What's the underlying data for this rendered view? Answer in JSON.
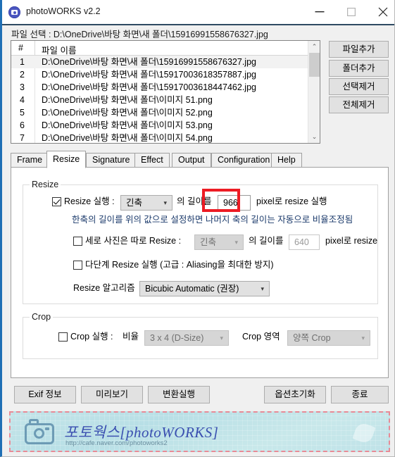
{
  "window": {
    "title": "photoWORKS v2.2",
    "icon": "camera-circle-icon",
    "controls": {
      "minimize": "—",
      "maximize": "□",
      "close": "✕"
    }
  },
  "path_line": "파일 선택 :  D:\\OneDrive\\바탕 화면\\새 폴더\\15916991558676327.jpg",
  "file_list": {
    "columns": [
      "#",
      "파일 이름"
    ],
    "rows": [
      {
        "num": "1",
        "name": "D:\\OneDrive\\바탕 화면\\새 폴더\\15916991558676327.jpg"
      },
      {
        "num": "2",
        "name": "D:\\OneDrive\\바탕 화면\\새 폴더\\15917003618357887.jpg"
      },
      {
        "num": "3",
        "name": "D:\\OneDrive\\바탕 화면\\새 폴더\\15917003618447462.jpg"
      },
      {
        "num": "4",
        "name": "D:\\OneDrive\\바탕 화면\\새 폴더\\이미지 51.png"
      },
      {
        "num": "5",
        "name": "D:\\OneDrive\\바탕 화면\\새 폴더\\이미지 52.png"
      },
      {
        "num": "6",
        "name": "D:\\OneDrive\\바탕 화면\\새 폴더\\이미지 53.png"
      },
      {
        "num": "7",
        "name": "D:\\OneDrive\\바탕 화면\\새 폴더\\이미지 54.png"
      }
    ],
    "scrollbar": {
      "up": "⌃",
      "down": "⌄"
    }
  },
  "side_buttons": [
    {
      "label": "파일추가"
    },
    {
      "label": "폴더추가"
    },
    {
      "label": "선택제거"
    },
    {
      "label": "전체제거"
    }
  ],
  "tabs": [
    {
      "label": "Frame",
      "active": false
    },
    {
      "label": "Resize",
      "active": true
    },
    {
      "label": "Signature",
      "active": false
    },
    {
      "label": "Effect",
      "active": false
    },
    {
      "label": "Output",
      "active": false
    },
    {
      "label": "Configuration",
      "active": false
    },
    {
      "label": "Help",
      "active": false
    }
  ],
  "resize_group": {
    "legend": "Resize",
    "enable_label": "Resize 실행 :",
    "enable_checked": true,
    "axis_value": "긴축",
    "mid_label": "의 길이를",
    "pixel_value": "966",
    "suffix_label": "pixel로 resize 실행",
    "hint": "한축의 길이를 위의 값으로 설정하면 나머지 축의 길이는 자동으로 비율조정됨",
    "portrait_label": "세로 사진은 따로 Resize :",
    "portrait_checked": false,
    "portrait_axis": "긴축",
    "portrait_mid": "의 길이를",
    "portrait_value": "640",
    "portrait_suffix": "pixel로 resize",
    "multistep_label": "다단계 Resize 실행 (고급 : Aliasing을 최대한 방지)",
    "multistep_checked": false,
    "algorithm_label": "Resize 알고리즘",
    "algorithm_value": "Bicubic Automatic (권장)"
  },
  "crop_group": {
    "legend": "Crop",
    "enable_label": "Crop 실행 :",
    "enable_checked": false,
    "ratio_label": "비율",
    "ratio_value": "3 x 4 (D-Size)",
    "area_label": "Crop 영역",
    "area_value": "양쪽 Crop"
  },
  "bottom_buttons": [
    {
      "label": "Exif 정보"
    },
    {
      "label": "미리보기"
    },
    {
      "label": "변환실행"
    },
    {
      "label": "옵션초기화"
    },
    {
      "label": "종료"
    }
  ],
  "banner": {
    "title": "포토웍스[photoWORKS]",
    "url": "http://cafe.naver.com/photoworks2",
    "icon": "camera-icon"
  },
  "highlight": {
    "color": "#ed1c24",
    "target": "pixel-value-input"
  }
}
